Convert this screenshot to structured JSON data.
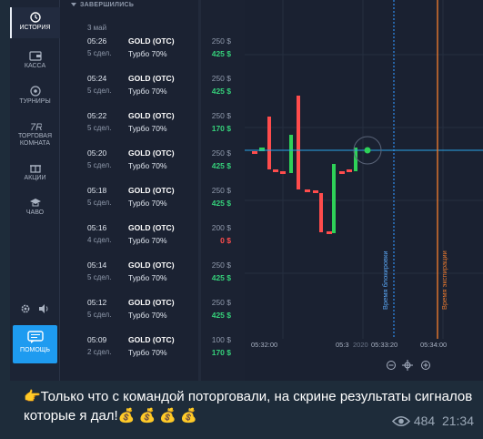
{
  "sidebar": {
    "items": [
      {
        "label": "ИСТОРИЯ",
        "icon": "history-icon"
      },
      {
        "label": "КАССА",
        "icon": "wallet-icon"
      },
      {
        "label": "ТУРНИРЫ",
        "icon": "tournament-icon"
      },
      {
        "label_line1": "ТОРГОВАЯ",
        "label_line2": "КОМНАТА",
        "icon": "trading-room-icon"
      },
      {
        "label": "АКЦИИ",
        "icon": "gift-icon"
      },
      {
        "label": "ЧАВО",
        "icon": "graduation-cap-icon"
      }
    ],
    "help_label": "ПОМОЩЬ"
  },
  "trades": {
    "header": "ЗАВЕРШИЛИСЬ",
    "date": "3 май",
    "rows": [
      {
        "time": "05:26",
        "deals": "5 сдел.",
        "asset": "GOLD (OTC)",
        "type": "Турбо 70%",
        "amount": "250 $",
        "profit": "425 $",
        "result": "win"
      },
      {
        "time": "05:24",
        "deals": "5 сдел.",
        "asset": "GOLD (OTC)",
        "type": "Турбо 70%",
        "amount": "250 $",
        "profit": "425 $",
        "result": "win"
      },
      {
        "time": "05:22",
        "deals": "5 сдел.",
        "asset": "GOLD (OTC)",
        "type": "Турбо 70%",
        "amount": "250 $",
        "profit": "170 $",
        "result": "win"
      },
      {
        "time": "05:20",
        "deals": "5 сдел.",
        "asset": "GOLD (OTC)",
        "type": "Турбо 70%",
        "amount": "250 $",
        "profit": "425 $",
        "result": "win"
      },
      {
        "time": "05:18",
        "deals": "5 сдел.",
        "asset": "GOLD (OTC)",
        "type": "Турбо 70%",
        "amount": "250 $",
        "profit": "425 $",
        "result": "win"
      },
      {
        "time": "05:16",
        "deals": "4 сдел.",
        "asset": "GOLD (OTC)",
        "type": "Турбо 70%",
        "amount": "200 $",
        "profit": "0 $",
        "result": "loss"
      },
      {
        "time": "05:14",
        "deals": "5 сдел.",
        "asset": "GOLD (OTC)",
        "type": "Турбо 70%",
        "amount": "250 $",
        "profit": "425 $",
        "result": "win"
      },
      {
        "time": "05:12",
        "deals": "5 сдел.",
        "asset": "GOLD (OTC)",
        "type": "Турбо 70%",
        "amount": "250 $",
        "profit": "425 $",
        "result": "win"
      },
      {
        "time": "05:09",
        "deals": "2 сдел.",
        "asset": "GOLD (OTC)",
        "type": "Турбо 70%",
        "amount": "100 $",
        "profit": "170 $",
        "result": "win"
      }
    ]
  },
  "chart": {
    "lock_label": "Время блокировки",
    "expiry_label": "Время экспирации",
    "time_labels": [
      "05:32:00",
      "05:33:20",
      "05:34:00"
    ],
    "partial_label": "05:3",
    "partial_year": "2020",
    "colors": {
      "up": "#2ed158",
      "down": "#ff4c4c",
      "lock": "#2f8df0",
      "expiry": "#e8782e",
      "price_line": "#2ba5e8"
    }
  },
  "message": {
    "text": "👉Только что с командой поторговали, на скрине результаты сигналов которые я дал!💰 💰 💰 💰",
    "views": "484",
    "time": "21:34"
  }
}
